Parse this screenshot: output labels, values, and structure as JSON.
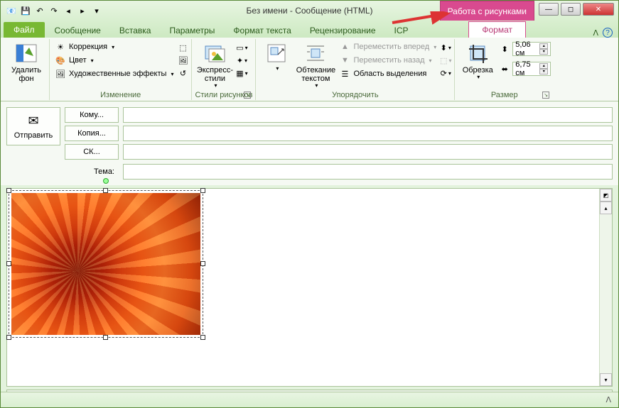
{
  "titlebar": {
    "title": "Без имени  -  Сообщение (HTML)",
    "contextual": "Работа с рисунками"
  },
  "tabs": {
    "file": "Файл",
    "items": [
      "Сообщение",
      "Вставка",
      "Параметры",
      "Формат текста",
      "Рецензирование",
      "ICP"
    ],
    "format": "Формат"
  },
  "ribbon": {
    "removeBg": "Удалить\nфон",
    "adjust": {
      "correction": "Коррекция",
      "color": "Цвет",
      "effects": "Художественные эффекты",
      "label": "Изменение"
    },
    "styles": {
      "express": "Экспресс-стили",
      "label": "Стили рисунков"
    },
    "arrange": {
      "wrap": "Обтекание\nтекстом",
      "forward": "Переместить вперед",
      "backward": "Переместить назад",
      "selection": "Область выделения",
      "label": "Упорядочить"
    },
    "size": {
      "crop": "Обрезка",
      "h": "5,06 см",
      "w": "6,75 см",
      "label": "Размер"
    }
  },
  "compose": {
    "send": "Отправить",
    "to": "Кому...",
    "cc": "Копия...",
    "bcc": "СК...",
    "subjectLabel": "Тема:"
  }
}
